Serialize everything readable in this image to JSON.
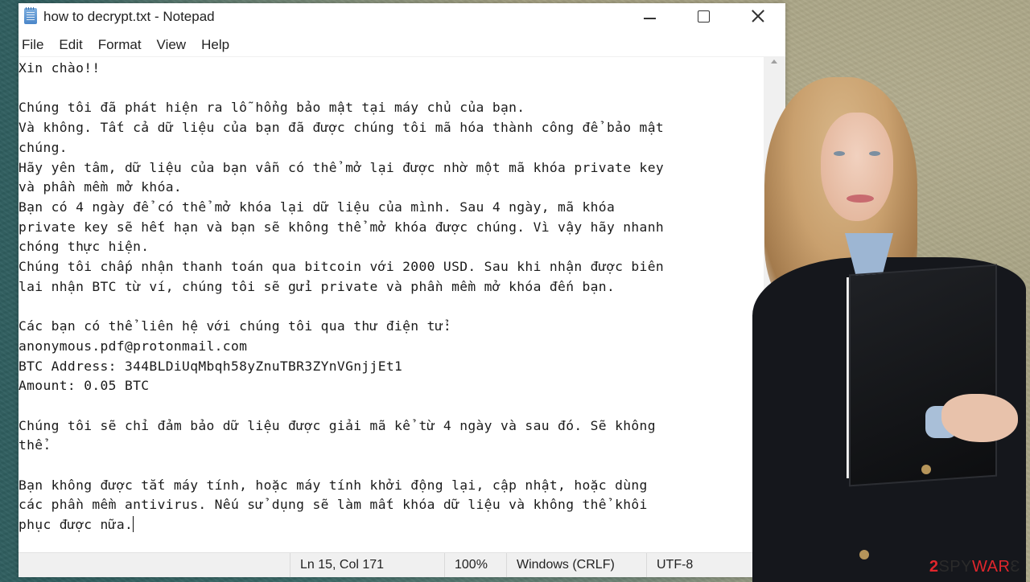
{
  "window": {
    "title": "how to decrypt.txt - Notepad",
    "controls": [
      "minimize",
      "maximize",
      "close"
    ]
  },
  "menu": {
    "items": [
      "File",
      "Edit",
      "Format",
      "View",
      "Help"
    ]
  },
  "document": {
    "lines": [
      "Xin chào!!",
      "",
      "Chúng tôi đã phát hiện ra lỗ hổng bảo mật tại máy chủ của bạn.",
      "Và không. Tất cả dữ liệu của bạn đã được chúng tôi mã hóa thành công để bảo mật",
      "chúng.",
      "Hãy yên tâm, dữ liệu của bạn vẫn có thể mở lại được nhờ một mã khóa private key",
      "và phần mềm mở khóa.",
      "Bạn có 4 ngày để có thể mở khóa lại dữ liệu của mình. Sau 4 ngày, mã khóa",
      "private key sẽ hết hạn và bạn sẽ không thể mở khóa được chúng. Vì vậy hãy nhanh",
      "chóng thực hiện.",
      "Chúng tôi chấp nhận thanh toán qua bitcoin với 2000 USD. Sau khi nhận được biên",
      "lai nhận BTC từ ví, chúng tôi sẽ gửi private và phần mềm mở khóa đến bạn.",
      "",
      "Các bạn có thể liên hệ với chúng tôi qua thư điện tử:",
      "anonymous.pdf@protonmail.com",
      "BTC Address: 344BLDiUqMbqh58yZnuTBR3ZYnVGnjjEt1",
      "Amount: 0.05 BTC",
      "",
      "Chúng tôi sẽ chỉ đảm bảo dữ liệu được giải mã kể từ 4 ngày và sau đó. Sẽ không",
      "thể.",
      "",
      "Bạn không được tắt máy tính, hoặc máy tính khởi động lại, cập nhật, hoặc dùng",
      "các phần mềm antivirus. Nếu sử dụng sẽ làm mất khóa dữ liệu và không thể khôi",
      "phục được nữa."
    ]
  },
  "statusbar": {
    "position": "Ln 15, Col 171",
    "zoom": "100%",
    "line_ending": "Windows (CRLF)",
    "encoding": "UTF-8"
  },
  "watermark": {
    "prefix": "2",
    "middle": "SPY",
    "suffix": "WAR",
    "end_glyph": "Ɛ"
  },
  "colors": {
    "watermark_red": "#e0262c",
    "window_bg": "#ffffff",
    "statusbar_bg": "#f0f0f0"
  }
}
